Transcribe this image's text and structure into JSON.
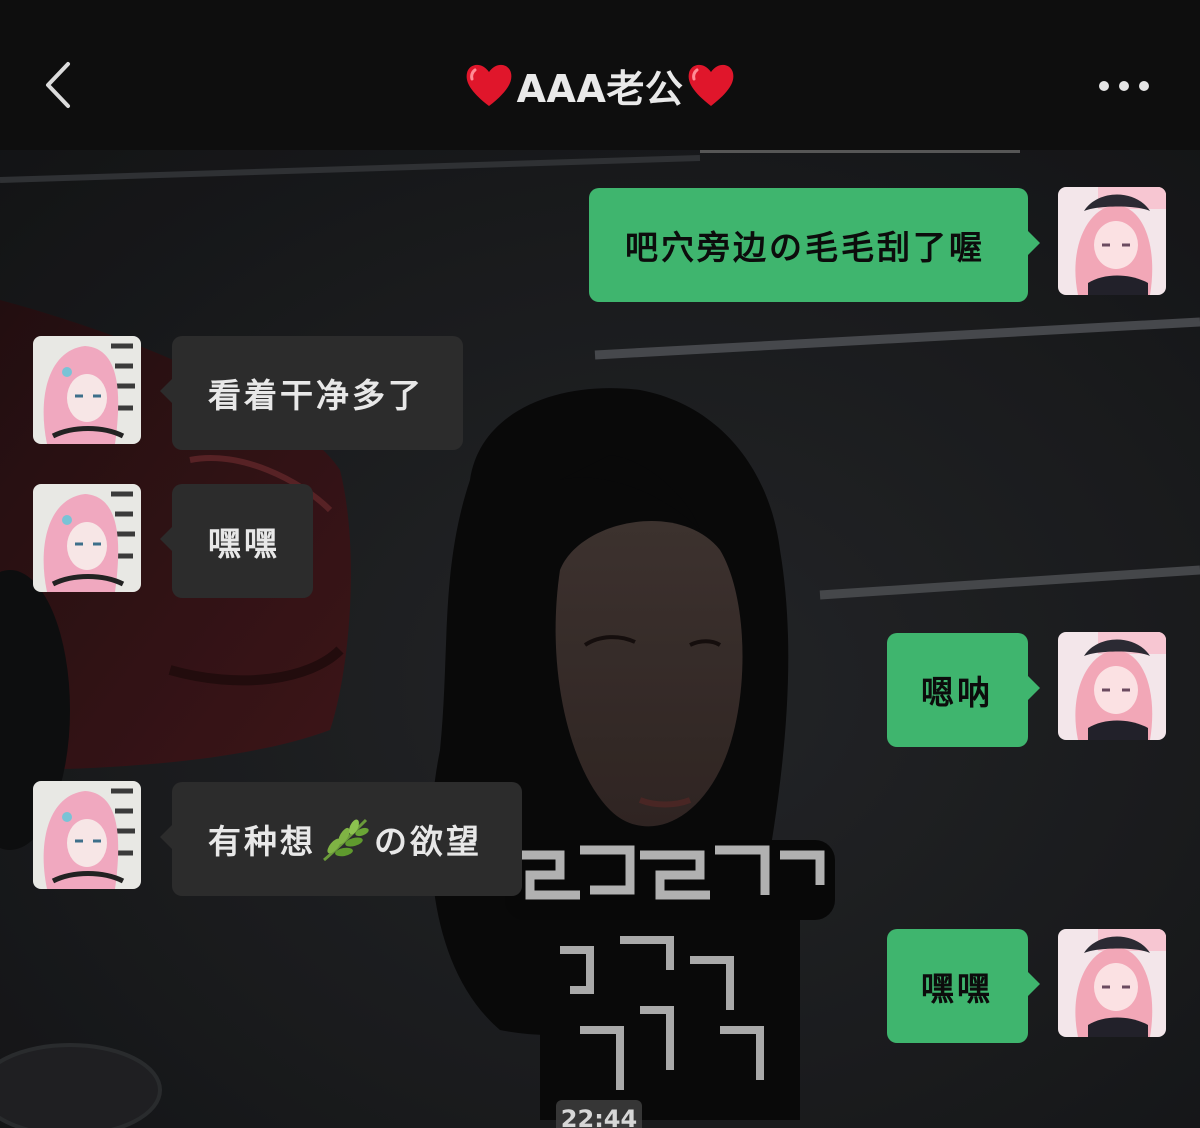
{
  "header": {
    "title": "AAA老公",
    "left_icon": "heart-emoji",
    "right_icon": "heart-emoji",
    "back_icon": "chevron-left-icon",
    "more_icon": "more-dots-icon"
  },
  "messages": [
    {
      "side": "right",
      "text": "吧穴旁边の毛毛刮了喔"
    },
    {
      "side": "left",
      "text": "看着干净多了"
    },
    {
      "side": "left",
      "text": "嘿嘿"
    },
    {
      "side": "right",
      "text": "嗯呐"
    },
    {
      "side": "left",
      "text_before": "有种想",
      "icon": "herb-emoji",
      "text_after": "の欲望"
    },
    {
      "side": "right",
      "text": "嘿嘿"
    }
  ],
  "timestamp": "22:44",
  "colors": {
    "header_bg": "#0e0e0e",
    "sent_bubble": "#3fb56e",
    "received_bubble": "#2c2c2c",
    "heart": "#e0162b"
  }
}
